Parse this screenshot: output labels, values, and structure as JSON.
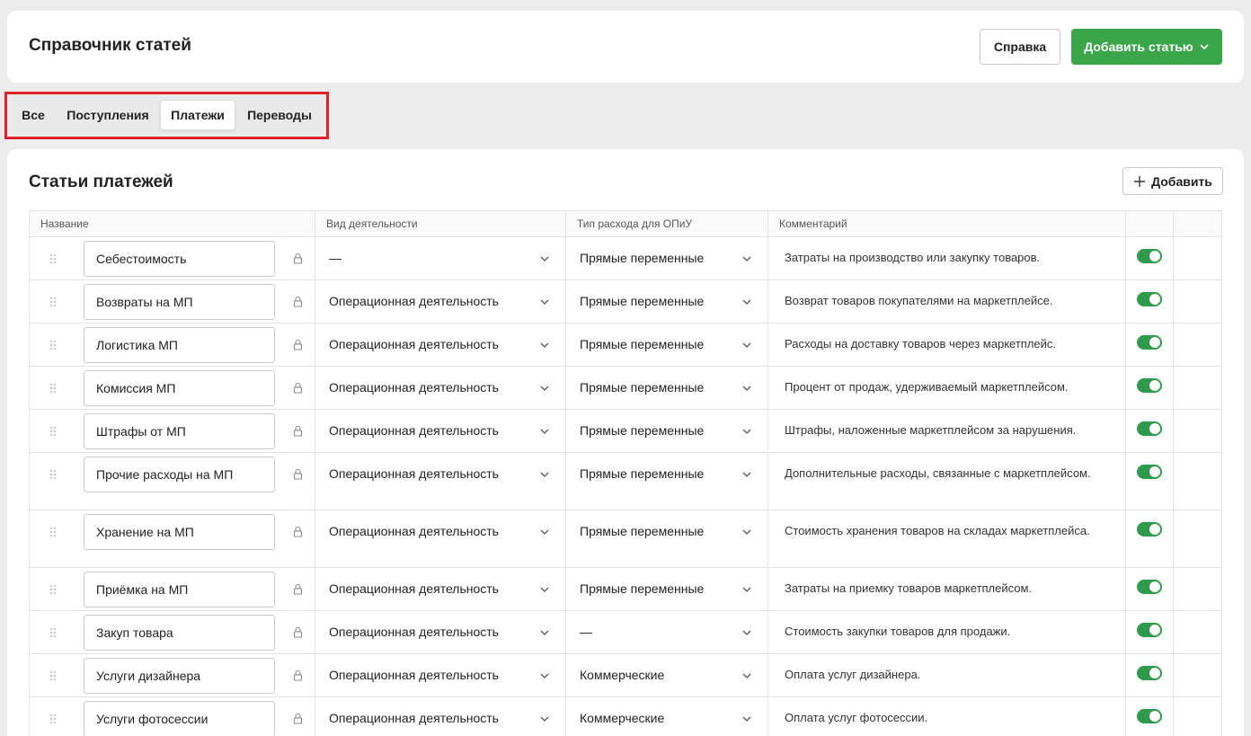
{
  "header": {
    "title": "Справочник статей",
    "help_label": "Справка",
    "add_article_label": "Добавить статью"
  },
  "tabs": [
    {
      "label": "Все",
      "active": false
    },
    {
      "label": "Поступления",
      "active": false
    },
    {
      "label": "Платежи",
      "active": true
    },
    {
      "label": "Переводы",
      "active": false
    }
  ],
  "section": {
    "title": "Статьи платежей",
    "add_label": "Добавить"
  },
  "table": {
    "columns": [
      "Название",
      "Вид деятельности",
      "Тип расхода для ОПиУ",
      "Комментарий",
      "",
      ""
    ],
    "rows": [
      {
        "name": "Себестоимость",
        "activity": "—",
        "expense_type": "Прямые переменные",
        "comment": "Затраты на производство или закупку товаров.",
        "enabled": true
      },
      {
        "name": "Возвраты на МП",
        "activity": "Операционная деятельность",
        "expense_type": "Прямые переменные",
        "comment": "Возврат товаров покупателями на маркетплейсе.",
        "enabled": true
      },
      {
        "name": "Логистика МП",
        "activity": "Операционная деятельность",
        "expense_type": "Прямые переменные",
        "comment": "Расходы на доставку товаров через маркетплейс.",
        "enabled": true
      },
      {
        "name": "Комиссия МП",
        "activity": "Операционная деятельность",
        "expense_type": "Прямые переменные",
        "comment": "Процент от продаж, удерживаемый маркетплейсом.",
        "enabled": true
      },
      {
        "name": "Штрафы от МП",
        "activity": "Операционная деятельность",
        "expense_type": "Прямые переменные",
        "comment": "Штрафы, наложенные маркетплейсом за нарушения.",
        "enabled": true
      },
      {
        "name": "Прочие расходы на МП",
        "activity": "Операционная деятельность",
        "expense_type": "Прямые переменные",
        "comment": "Дополнительные расходы, связанные с маркетплейсом.",
        "enabled": true
      },
      {
        "name": "Хранение на МП",
        "activity": "Операционная деятельность",
        "expense_type": "Прямые переменные",
        "comment": "Стоимость хранения товаров на складах маркетплейса.",
        "enabled": true
      },
      {
        "name": "Приёмка на МП",
        "activity": "Операционная деятельность",
        "expense_type": "Прямые переменные",
        "comment": "Затраты на приемку товаров маркетплейсом.",
        "enabled": true
      },
      {
        "name": "Закуп товара",
        "activity": "Операционная деятельность",
        "expense_type": "—",
        "comment": "Стоимость закупки товаров для продажи.",
        "enabled": true
      },
      {
        "name": "Услуги дизайнера",
        "activity": "Операционная деятельность",
        "expense_type": "Коммерческие",
        "comment": "Оплата услуг дизайнера.",
        "enabled": true
      },
      {
        "name": "Услуги фотосессии",
        "activity": "Операционная деятельность",
        "expense_type": "Коммерческие",
        "comment": "Оплата услуг фотосессии.",
        "enabled": true
      }
    ]
  },
  "colors": {
    "accent_green": "#3ba54a",
    "toggle_green": "#2f9a4c",
    "highlight_red": "#e0202a"
  }
}
